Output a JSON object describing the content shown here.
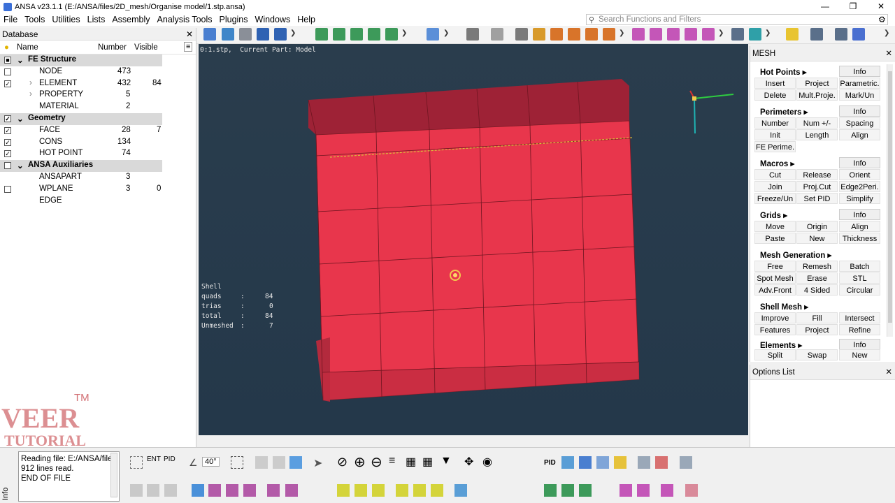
{
  "window": {
    "title": "ANSA v23.1.1 (E:/ANSA/files/2D_mesh/Organise model/1.stp.ansa)"
  },
  "menu": [
    "File",
    "Tools",
    "Utilities",
    "Lists",
    "Assembly",
    "Analysis Tools",
    "Plugins",
    "Windows",
    "Help"
  ],
  "search": {
    "placeholder": "Search Functions and Filters"
  },
  "database": {
    "title": "Database",
    "columns": {
      "name": "Name",
      "number": "Number",
      "visible": "Visible"
    },
    "rows": [
      {
        "label": "FE Structure",
        "group": true,
        "number": "",
        "visible": ""
      },
      {
        "label": "NODE",
        "group": false,
        "number": "473",
        "visible": ""
      },
      {
        "label": "ELEMENT",
        "group": false,
        "number": "432",
        "visible": "84"
      },
      {
        "label": "PROPERTY",
        "group": false,
        "number": "5",
        "visible": ""
      },
      {
        "label": "MATERIAL",
        "group": false,
        "number": "2",
        "visible": ""
      },
      {
        "label": "Geometry",
        "group": true,
        "number": "",
        "visible": ""
      },
      {
        "label": "FACE",
        "group": false,
        "number": "28",
        "visible": "7"
      },
      {
        "label": "CONS",
        "group": false,
        "number": "134",
        "visible": ""
      },
      {
        "label": "HOT POINT",
        "group": false,
        "number": "74",
        "visible": ""
      },
      {
        "label": "ANSA Auxiliaries",
        "group": true,
        "number": "",
        "visible": ""
      },
      {
        "label": "ANSAPART",
        "group": false,
        "number": "3",
        "visible": ""
      },
      {
        "label": "WPLANE",
        "group": false,
        "number": "3",
        "visible": "0"
      },
      {
        "label": "EDGE",
        "group": false,
        "number": "",
        "visible": ""
      }
    ]
  },
  "viewport": {
    "header": "0:1.stp,  Current Part: Model",
    "stats": {
      "title": "Shell",
      "quads_label": "quads",
      "quads": "84",
      "trias_label": "trias",
      "trias": "0",
      "total_label": "total",
      "total": "84",
      "unmeshed_label": "Unmeshed",
      "unmeshed": "7"
    },
    "mesh_color": "#e8364c"
  },
  "mesh": {
    "title": "MESH",
    "sections": [
      {
        "name": "Hot Points ▸",
        "buttons": [
          "Info",
          "Insert",
          "Project",
          "Parametric.",
          "Delete",
          "Mult.Proje.",
          "Mark/Un"
        ]
      },
      {
        "name": "Perimeters ▸",
        "buttons": [
          "Info",
          "Number",
          "Num +/-",
          "Spacing",
          "Init",
          "Length",
          "Align",
          "FE Perime."
        ]
      },
      {
        "name": "Macros ▸",
        "buttons": [
          "Info",
          "Cut",
          "Release",
          "Orient",
          "Join",
          "Proj.Cut",
          "Edge2Peri.",
          "Freeze/Un",
          "Set PID",
          "Simplify"
        ]
      },
      {
        "name": "Grids ▸",
        "buttons": [
          "Info",
          "Move",
          "Origin",
          "Align",
          "Paste",
          "New",
          "Thickness"
        ]
      },
      {
        "name": "Mesh Generation ▸",
        "buttons": [
          "Free",
          "Remesh",
          "Batch",
          "Spot Mesh",
          "Erase",
          "STL",
          "Adv.Front",
          "4 Sided",
          "Circular"
        ]
      },
      {
        "name": "Shell Mesh ▸",
        "buttons": [
          "Improve",
          "Fill",
          "Intersect",
          "Features",
          "Project",
          "Refine"
        ]
      },
      {
        "name": "Elements ▸",
        "buttons": [
          "Info",
          "Split",
          "Swap",
          "New"
        ]
      }
    ]
  },
  "options": {
    "title": "Options List"
  },
  "console": {
    "lines": [
      "Reading file: E:/ANSA/file",
      "912 lines read.",
      "END OF FILE"
    ],
    "info_label": "Info"
  },
  "bottom_toolbar": {
    "ent_label": "ENT",
    "pid_label": "PID",
    "angle": "40°",
    "pid_icon_label": "PID"
  },
  "logo": {
    "line1": "VEER",
    "line2": "TUTORIAL",
    "tm": "TM"
  }
}
